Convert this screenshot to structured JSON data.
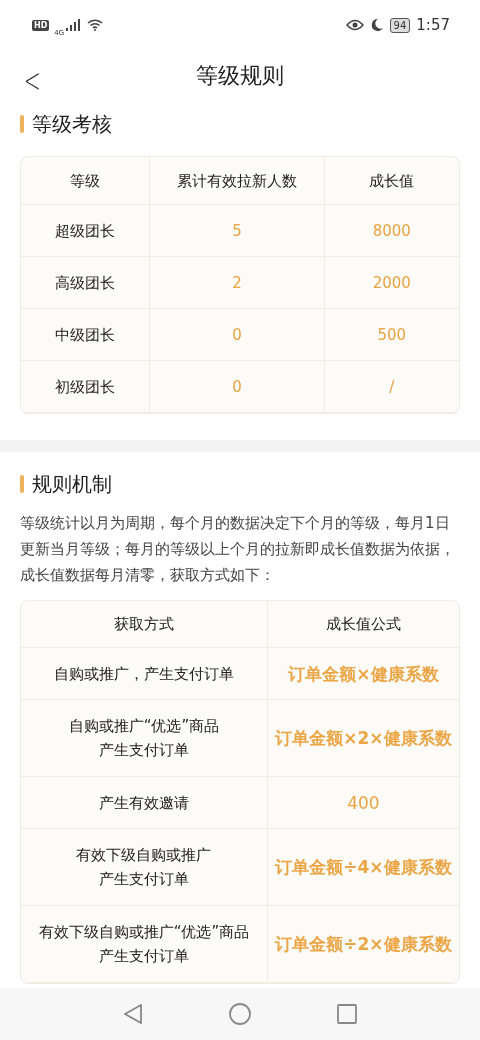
{
  "status_bar": {
    "hd": "HD",
    "network": "4G",
    "battery": "94",
    "time": "1:57"
  },
  "header": {
    "back": "<",
    "title": "等级规则"
  },
  "sections": [
    {
      "title": "等级考核",
      "table": {
        "columns": [
          {
            "label": "等级",
            "accent": false
          },
          {
            "label": "累计有效拉新人数",
            "accent": true
          },
          {
            "label": "成长值",
            "accent": true
          }
        ],
        "rows": [
          [
            "超级团长",
            "5",
            "8000"
          ],
          [
            "高级团长",
            "2",
            "2000"
          ],
          [
            "中级团长",
            "0",
            "500"
          ],
          [
            "初级团长",
            "0",
            "/"
          ]
        ]
      }
    },
    {
      "title": "规则机制",
      "text": "等级统计以月为周期，每个月的数据决定下个月的等级，每月1日更新当月等级；每月的等级以上个月的拉新即成长值数据为依据，成长值数据每月清零，获取方式如下：",
      "table": {
        "columns": [
          {
            "label": "获取方式",
            "accent": false
          },
          {
            "label": "成长值公式",
            "accent": true
          }
        ],
        "rows": [
          [
            "自购或推广，产生支付订单",
            "订单金额×健康系数"
          ],
          [
            [
              "自购或推广“优选”商品",
              "产生支付订单"
            ],
            "订单金额×2×健康系数"
          ],
          [
            "产生有效邀请",
            "400"
          ],
          [
            [
              "有效下级自购或推广",
              "产生支付订单"
            ],
            "订单金额÷4×健康系数"
          ],
          [
            [
              "有效下级自购或推广“优选”商品",
              "产生支付订单"
            ],
            "订单金额÷2×健康系数"
          ]
        ]
      }
    }
  ]
}
